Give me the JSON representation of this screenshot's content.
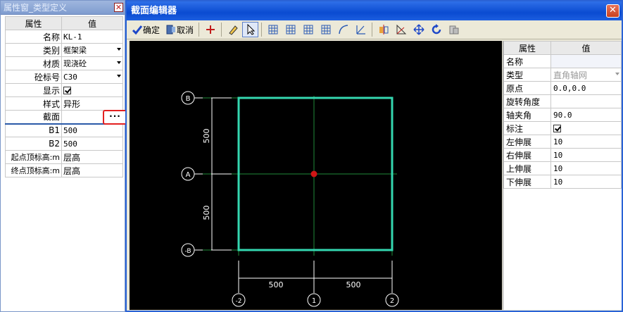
{
  "left_panel": {
    "title": "属性窗_类型定义",
    "close_glyph": "✕",
    "col_property": "属性",
    "col_value": "值",
    "rows": [
      {
        "key": "名称",
        "value": "KL-1"
      },
      {
        "key": "类别",
        "value": "框架梁",
        "dropdown": true
      },
      {
        "key": "材质",
        "value": "现浇砼",
        "dropdown": true
      },
      {
        "key": "砼标号",
        "value": "C30",
        "dropdown": true
      },
      {
        "key": "显示",
        "value": "",
        "checkbox": true
      },
      {
        "key": "样式",
        "value": "异形"
      },
      {
        "key": "截面",
        "value": ""
      },
      {
        "key": "B1",
        "value": "500"
      },
      {
        "key": "B2",
        "value": "500"
      },
      {
        "key": "起点顶标高:m",
        "value": "层高"
      },
      {
        "key": "终点顶标高:m",
        "value": "层高"
      }
    ],
    "ellipsis_label": "···"
  },
  "dialog": {
    "title": "截面编辑器",
    "close_glyph": "✕",
    "toolbar": {
      "ok_label": "确定",
      "cancel_label": "取消"
    }
  },
  "drawing": {
    "axis_labels": {
      "top_left": "B",
      "mid_left": "A",
      "bottom_left": "-B",
      "bottom_1": "-2",
      "bottom_2": "1",
      "bottom_3": "2"
    },
    "dim_labels": {
      "left_upper": "500",
      "left_lower": "500",
      "bottom_left": "500",
      "bottom_right": "500"
    },
    "colors": {
      "rect": "#34d7b0",
      "grid": "#1f8a3a",
      "origin": "#d01515",
      "dim": "#ffffff"
    }
  },
  "right_panel": {
    "col_property": "属性",
    "col_value": "值",
    "rows": [
      {
        "key": "名称",
        "value": ""
      },
      {
        "key": "类型",
        "value": "直角轴网",
        "gray": true,
        "dropdown": true
      },
      {
        "key": "原点",
        "value": "0.0,0.0"
      },
      {
        "key": "旋转角度",
        "value": ""
      },
      {
        "key": "轴夹角",
        "value": "90.0"
      },
      {
        "key": "标注",
        "value": "",
        "checkbox": true
      },
      {
        "key": "左伸展",
        "value": "10"
      },
      {
        "key": "右伸展",
        "value": "10"
      },
      {
        "key": "上伸展",
        "value": "10"
      },
      {
        "key": "下伸展",
        "value": "10"
      }
    ]
  }
}
